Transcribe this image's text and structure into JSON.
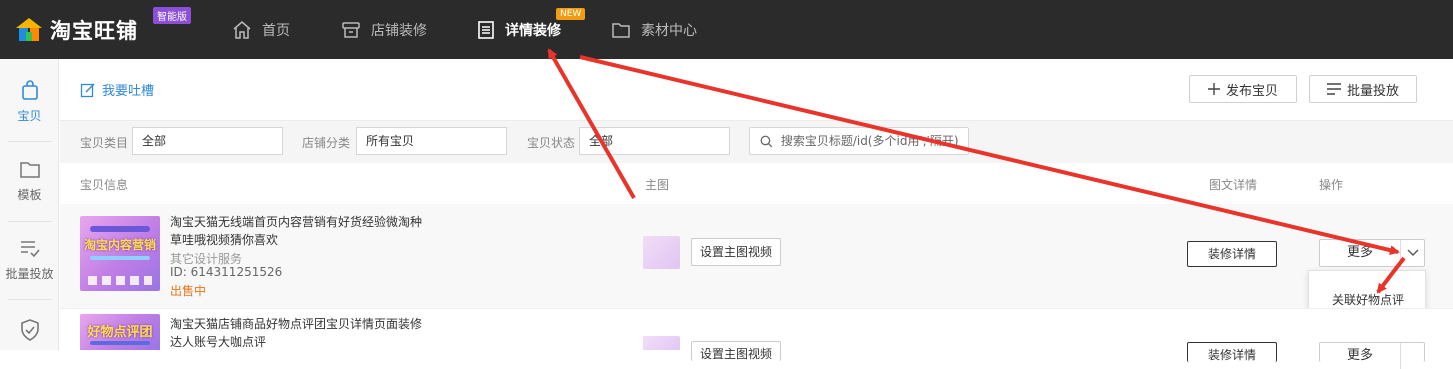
{
  "header": {
    "logo_text": "淘宝旺铺",
    "edition_badge": "智能版",
    "nav": [
      {
        "label": "首页",
        "icon": "home-icon"
      },
      {
        "label": "店铺装修",
        "icon": "store-icon"
      },
      {
        "label": "详情装修",
        "icon": "document-icon",
        "badge": "NEW",
        "active": true
      },
      {
        "label": "素材中心",
        "icon": "folder-icon"
      }
    ]
  },
  "sidebar": {
    "items": [
      {
        "label": "宝贝",
        "icon": "bag-icon",
        "active": true
      },
      {
        "label": "模板",
        "icon": "folder-icon"
      },
      {
        "label": "批量投放",
        "icon": "list-check-icon"
      },
      {
        "label": "",
        "icon": "shield-icon"
      }
    ]
  },
  "toolbar": {
    "feedback_label": "我要吐槽",
    "publish_label": "发布宝贝",
    "batch_label": "批量投放"
  },
  "filters": {
    "category_label": "宝贝类目",
    "category_value": "全部",
    "shop_category_label": "店铺分类",
    "shop_category_value": "所有宝贝",
    "status_label": "宝贝状态",
    "status_value": "全部",
    "search_placeholder": "搜索宝贝标题/id(多个id用','隔开)"
  },
  "table": {
    "headers": {
      "info": "宝贝信息",
      "main_image": "主图",
      "detail": "图文详情",
      "action": "操作"
    },
    "rows": [
      {
        "thumb_text": "淘宝内容营销",
        "title": "淘宝天猫无线端首页内容营销有好货经验微淘种草哇哦视频猜你喜欢",
        "category": "其它设计服务",
        "id_text": "ID: 614311251526",
        "status": "出售中",
        "set_video_label": "设置主图视频",
        "decorate_label": "装修详情",
        "more_label": "更多"
      },
      {
        "thumb_text": "好物点评团",
        "title": "淘宝天猫店铺商品好物点评团宝贝详情页面装修达人账号大咖点评",
        "set_video_label": "设置主图视频",
        "decorate_label": "装修详情",
        "more_label": "更多"
      }
    ]
  },
  "dropdown": {
    "option": "关联好物点评"
  },
  "colors": {
    "topbar": "#2b2b2b",
    "accent_blue": "#3089dc",
    "status_orange": "#e8741b",
    "new_badge": "#f39c12",
    "edition_badge": "#8c4fd8",
    "annotation_arrow": "#e8342a"
  }
}
